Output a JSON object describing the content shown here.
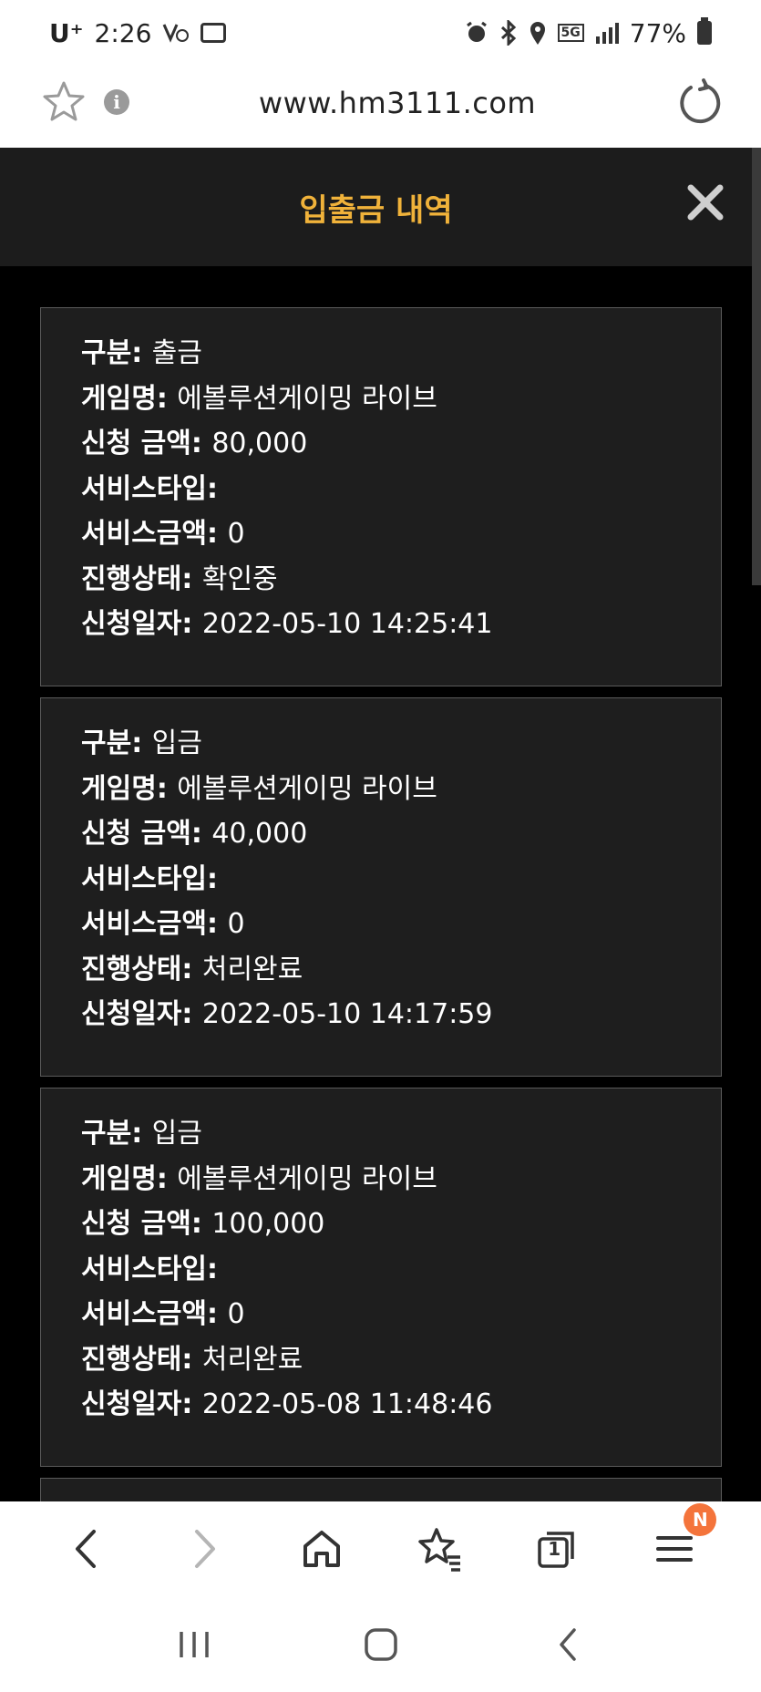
{
  "status_bar": {
    "carrier": "U⁺",
    "time": "2:26",
    "battery": "77%",
    "network": "5G"
  },
  "browser": {
    "url": "www.hm3111.com",
    "tab_count": "1",
    "menu_badge": "N"
  },
  "modal": {
    "title": "입출금 내역"
  },
  "labels": {
    "type": "구분",
    "game": "게임명",
    "amount": "신청 금액",
    "service_type": "서비스타입",
    "service_amount": "서비스금액",
    "status": "진행상태",
    "date": "신청일자"
  },
  "records": [
    {
      "type": "출금",
      "game": "에볼루션게이밍 라이브",
      "amount": "80,000",
      "service_type": "",
      "service_amount": "0",
      "status": "확인중",
      "date": "2022-05-10 14:25:41"
    },
    {
      "type": "입금",
      "game": "에볼루션게이밍 라이브",
      "amount": "40,000",
      "service_type": "",
      "service_amount": "0",
      "status": "처리완료",
      "date": "2022-05-10 14:17:59"
    },
    {
      "type": "입금",
      "game": "에볼루션게이밍 라이브",
      "amount": "100,000",
      "service_type": "",
      "service_amount": "0",
      "status": "처리완료",
      "date": "2022-05-08 11:48:46"
    }
  ],
  "colors": {
    "accent": "#f0b23a",
    "panel": "#1e1e1e",
    "header": "#1c1c1c",
    "badge": "#f4743b"
  }
}
